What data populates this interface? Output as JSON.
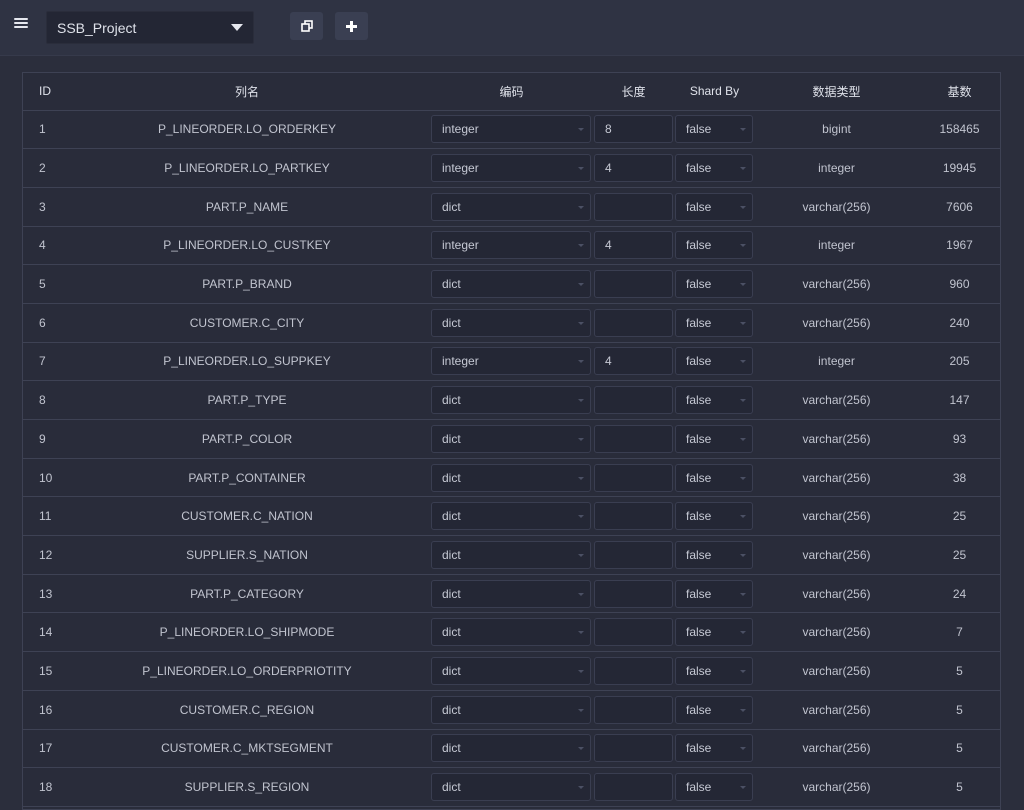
{
  "topbar": {
    "project_name": "SSB_Project"
  },
  "icons": {
    "menu": "hamburger-menu-icon",
    "caret": "caret-down-icon",
    "copy": "copy-icon",
    "add": "plus-icon"
  },
  "colors": {
    "background": "#2b2e3c",
    "topbar": "#2f3343",
    "table_border": "#3e4254",
    "text": "#c1c4cf"
  },
  "table": {
    "headers": {
      "id": "ID",
      "name": "列名",
      "encoding": "编码",
      "length": "长度",
      "shard_by": "Shard By",
      "data_type": "数据类型",
      "cardinality": "基数"
    },
    "rows": [
      {
        "id": "1",
        "name": "P_LINEORDER.LO_ORDERKEY",
        "encoding": "integer",
        "length": "8",
        "shard_by": "false",
        "data_type": "bigint",
        "cardinality": "158465"
      },
      {
        "id": "2",
        "name": "P_LINEORDER.LO_PARTKEY",
        "encoding": "integer",
        "length": "4",
        "shard_by": "false",
        "data_type": "integer",
        "cardinality": "19945"
      },
      {
        "id": "3",
        "name": "PART.P_NAME",
        "encoding": "dict",
        "length": "",
        "shard_by": "false",
        "data_type": "varchar(256)",
        "cardinality": "7606"
      },
      {
        "id": "4",
        "name": "P_LINEORDER.LO_CUSTKEY",
        "encoding": "integer",
        "length": "4",
        "shard_by": "false",
        "data_type": "integer",
        "cardinality": "1967"
      },
      {
        "id": "5",
        "name": "PART.P_BRAND",
        "encoding": "dict",
        "length": "",
        "shard_by": "false",
        "data_type": "varchar(256)",
        "cardinality": "960"
      },
      {
        "id": "6",
        "name": "CUSTOMER.C_CITY",
        "encoding": "dict",
        "length": "",
        "shard_by": "false",
        "data_type": "varchar(256)",
        "cardinality": "240"
      },
      {
        "id": "7",
        "name": "P_LINEORDER.LO_SUPPKEY",
        "encoding": "integer",
        "length": "4",
        "shard_by": "false",
        "data_type": "integer",
        "cardinality": "205"
      },
      {
        "id": "8",
        "name": "PART.P_TYPE",
        "encoding": "dict",
        "length": "",
        "shard_by": "false",
        "data_type": "varchar(256)",
        "cardinality": "147"
      },
      {
        "id": "9",
        "name": "PART.P_COLOR",
        "encoding": "dict",
        "length": "",
        "shard_by": "false",
        "data_type": "varchar(256)",
        "cardinality": "93"
      },
      {
        "id": "10",
        "name": "PART.P_CONTAINER",
        "encoding": "dict",
        "length": "",
        "shard_by": "false",
        "data_type": "varchar(256)",
        "cardinality": "38"
      },
      {
        "id": "11",
        "name": "CUSTOMER.C_NATION",
        "encoding": "dict",
        "length": "",
        "shard_by": "false",
        "data_type": "varchar(256)",
        "cardinality": "25"
      },
      {
        "id": "12",
        "name": "SUPPLIER.S_NATION",
        "encoding": "dict",
        "length": "",
        "shard_by": "false",
        "data_type": "varchar(256)",
        "cardinality": "25"
      },
      {
        "id": "13",
        "name": "PART.P_CATEGORY",
        "encoding": "dict",
        "length": "",
        "shard_by": "false",
        "data_type": "varchar(256)",
        "cardinality": "24"
      },
      {
        "id": "14",
        "name": "P_LINEORDER.LO_SHIPMODE",
        "encoding": "dict",
        "length": "",
        "shard_by": "false",
        "data_type": "varchar(256)",
        "cardinality": "7"
      },
      {
        "id": "15",
        "name": "P_LINEORDER.LO_ORDERPRIOTITY",
        "encoding": "dict",
        "length": "",
        "shard_by": "false",
        "data_type": "varchar(256)",
        "cardinality": "5"
      },
      {
        "id": "16",
        "name": "CUSTOMER.C_REGION",
        "encoding": "dict",
        "length": "",
        "shard_by": "false",
        "data_type": "varchar(256)",
        "cardinality": "5"
      },
      {
        "id": "17",
        "name": "CUSTOMER.C_MKTSEGMENT",
        "encoding": "dict",
        "length": "",
        "shard_by": "false",
        "data_type": "varchar(256)",
        "cardinality": "5"
      },
      {
        "id": "18",
        "name": "SUPPLIER.S_REGION",
        "encoding": "dict",
        "length": "",
        "shard_by": "false",
        "data_type": "varchar(256)",
        "cardinality": "5"
      }
    ]
  }
}
